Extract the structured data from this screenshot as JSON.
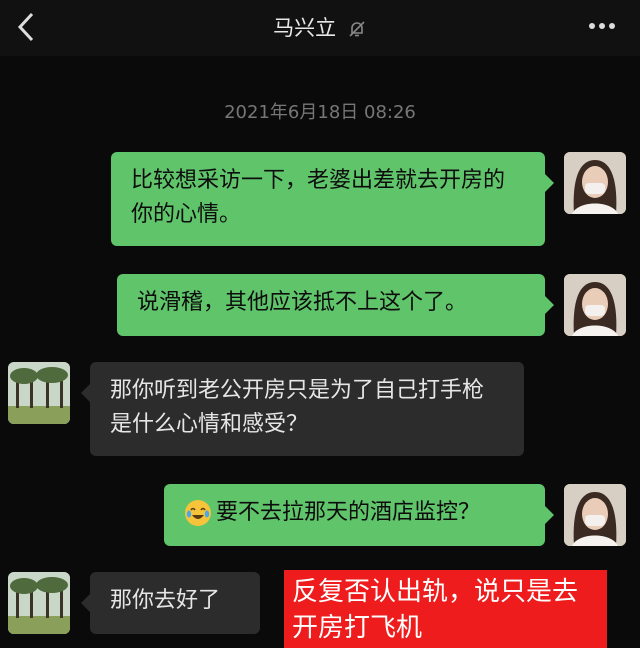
{
  "header": {
    "title": "马兴立"
  },
  "icons": {
    "back": "chevron-left-icon",
    "mute": "bell-off-icon",
    "more": "more-dots-icon"
  },
  "timestamp": "2021年6月18日 08:26",
  "messages": [
    {
      "from": "me",
      "text": "比较想采访一下，老婆出差就去开房的你的心情。"
    },
    {
      "from": "me",
      "text": "说滑稽，其他应该抵不上这个了。"
    },
    {
      "from": "other",
      "text": "那你听到老公开房只是为了自己打手枪是什么心情和感受？"
    },
    {
      "from": "me",
      "emoji": "laughing-crying-emoji",
      "text": "要不去拉那天的酒店监控？"
    },
    {
      "from": "other",
      "text": "那你去好了"
    }
  ],
  "annotation": "反复否认出轨，说只是去开房打飞机",
  "colors": {
    "out_bubble": "#5fc46a",
    "in_bubble": "#2c2c2c",
    "annotation": "#ee1c1c"
  }
}
